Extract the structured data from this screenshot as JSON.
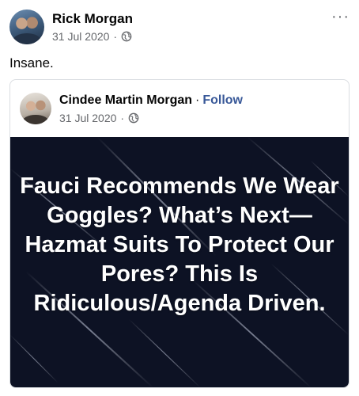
{
  "post": {
    "author": "Rick Morgan",
    "date": "31 Jul 2020",
    "separator": "·",
    "text": "Insane.",
    "more_label": "···"
  },
  "shared_post": {
    "author": "Cindee Martin Morgan",
    "separator": "·",
    "follow_label": "Follow",
    "date": "31 Jul 2020",
    "date_separator": "·",
    "image_headline": "Fauci Recommends We Wear Goggles? What’s Next—Hazmat Suits To Protect Our Pores? This Is Ridiculous/Agenda Driven."
  },
  "icons": {
    "privacy": "globe-icon",
    "menu": "more-options-icon"
  },
  "colors": {
    "link_blue": "#385898",
    "meta_gray": "#65676b",
    "image_background": "#0d1224"
  }
}
